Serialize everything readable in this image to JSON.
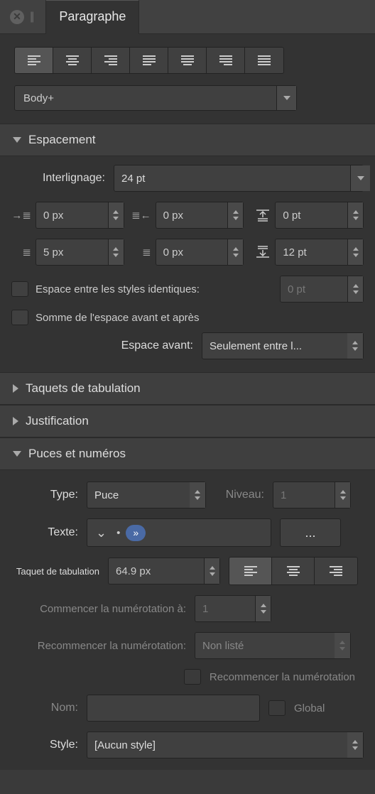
{
  "tab": {
    "title": "Paragraphe"
  },
  "style_select": "Body+",
  "sections": {
    "espacement": {
      "title": "Espacement",
      "interlignage_label": "Interlignage:",
      "interlignage_value": "24 pt",
      "indent_left": "0 px",
      "indent_right": "0 px",
      "space_before": "0 pt",
      "first_line": "5 px",
      "last_line": "0 px",
      "space_after": "12 pt",
      "check_same_style": "Espace entre les styles identiques:",
      "same_style_value": "0 pt",
      "check_sum": "Somme de l'espace avant et après",
      "space_before_label": "Espace avant:",
      "space_before_mode": "Seulement entre l..."
    },
    "tabstops": {
      "title": "Taquets de tabulation"
    },
    "justification": {
      "title": "Justification"
    },
    "bullets": {
      "title": "Puces et numéros",
      "type_label": "Type:",
      "type_value": "Puce",
      "level_label": "Niveau:",
      "level_value": "1",
      "text_label": "Texte:",
      "text_chevron": "⌄",
      "text_bullet": "•",
      "text_pill": "»",
      "more_button": "...",
      "tab_label": "Taquet de tabulation",
      "tab_value": "64.9 px",
      "start_at_label": "Commencer la numérotation à:",
      "start_at_value": "1",
      "restart_label": "Recommencer la numérotation:",
      "restart_value": "Non listé",
      "restart_check": "Recommencer la numérotation",
      "name_label": "Nom:",
      "name_value": "",
      "global_label": "Global",
      "style_label": "Style:",
      "style_value": "[Aucun style]"
    }
  }
}
